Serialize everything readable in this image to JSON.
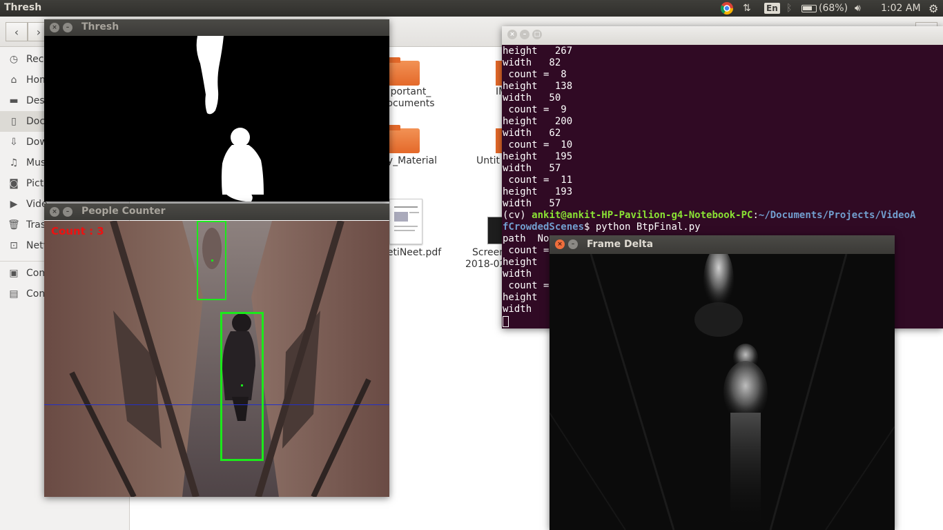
{
  "topbar": {
    "app_title": "Thresh",
    "keyboard_layout": "En",
    "battery": "(68%)",
    "clock": "1:02 AM"
  },
  "files": {
    "sidebar": [
      "Rece",
      "Hom",
      "Des",
      "Doc",
      "Dow",
      "Mus",
      "Pict",
      "Vide",
      "Tras",
      "Netv",
      "Com",
      "Con"
    ],
    "items": [
      {
        "label_line1": "portant_",
        "label_line2": "ocuments"
      },
      {
        "label_line1": "IM",
        "label_line2": ""
      },
      {
        "label_line1": "ly_Material",
        "label_line2": ""
      },
      {
        "label_line1": "Untit",
        "label_line2": ""
      },
      {
        "label_line1": "etiNeet.pdf",
        "label_line2": ""
      },
      {
        "label_line1": "Screen",
        "label_line2": "2018-02"
      }
    ]
  },
  "windows": {
    "thresh_title": "Thresh",
    "people_title": "People Counter",
    "delta_title": "Frame Delta",
    "count_overlay": "Count : 3"
  },
  "terminal": {
    "lines": [
      "height   267",
      "width   82",
      " count =  8",
      "height   138",
      "width   50",
      " count =  9",
      "height   200",
      "width   62",
      " count =  10",
      "height   195",
      "width   57",
      " count =  11",
      "height   193",
      "width   57"
    ],
    "prompt_env": "(cv) ",
    "prompt_user": "ankit@ankit-HP-Pavilion-g4-Notebook-PC",
    "prompt_path": "~/Documents/Projects/VideoA",
    "prompt_path_wrap": "fCrowdedScenes",
    "command": "$ python BtpFinal.py",
    "tail": [
      "path  No",
      " count = ",
      "height",
      "width",
      " count = ",
      "height",
      "width"
    ]
  }
}
